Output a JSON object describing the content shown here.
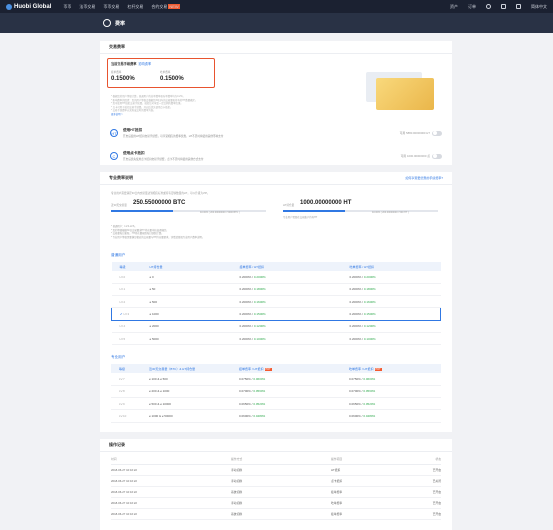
{
  "topbar": {
    "logo": "Huobi Global",
    "nav": [
      "币币",
      "法币交易",
      "币币交易",
      "杠杆交易",
      "合约交易"
    ],
    "new_tag": "NEW",
    "right": [
      "资产",
      "订单",
      "简体中文"
    ]
  },
  "page": {
    "title": "费率"
  },
  "fee_section": {
    "header": "交易费率",
    "current_rate_label": "当前交易手续费率",
    "current_rate_link": "影响费率",
    "maker_label": "挂单费率",
    "maker_value": "0.1500%",
    "taker_label": "吃单费率",
    "taker_value": "0.1500%",
    "notes": [
      "* 根据您的用户等级计算，普通用户的挂单费率和吃单费率均为0.2%。",
      "* 影响费率的因素：您的用户等级会根据您30日内的交易量和持有的HT数量确定。",
      "* 您可使用HT抵扣交易手续费，抵扣后可享受一定比例的费率优惠。",
      "* 点卡可用于抵扣交易手续费，开启后优先使用点卡抵扣。",
      "* 交易手续费率以实际成交时的费率为准。"
    ],
    "more_link": "更多说明 >"
  },
  "options": [
    {
      "icon": "HT",
      "title": "使用HT抵扣",
      "desc": "开启后使用HT抵扣交易手续费，可享受相应的费率优惠，HT不足时将使用其他币种支付",
      "right": "可用 5880.00000000 HT"
    },
    {
      "icon": "C",
      "title": "使用点卡抵扣",
      "desc": "开启后优先使用点卡抵扣交易手续费，点卡不足时将使用其他方式支付",
      "right": "可用 1000.00000000 点"
    }
  ],
  "vip": {
    "header": "专业费率说明",
    "header_link": "如何享受更优惠的手续费率?",
    "intro": "专业用户需要满足30日内交易量达到相应标准或持有足够数量的HT，可以升级为VIP。",
    "volume_label": "近30天交易量",
    "volume_value": "250.55000000 BTC",
    "volume_progress": 0.4,
    "volume_range": "40.00% ( 200.00000000 / 5000 BTC )",
    "ht_label": "HT持仓量",
    "ht_value": "1000.00000000 HT",
    "ht_progress": 0.4,
    "ht_range": "40.00% ( 200.00000000 / 500 HT )",
    "ht_note": "专业用户需要在交易账户持有HT",
    "rules": [
      "* 普通用户：LV.0-LV.6。",
      "* 您的等级根据30日交易量或HT持仓量中较高者确定。",
      "* 交易量每日更新，HT持仓量按照每日快照计算。",
      "* 专业用户等级需要满足相应的交易量与HT持仓量要求，详情请参阅专业用户费率说明。"
    ]
  },
  "normal_table": {
    "title": "普通用户",
    "headers": [
      "等级",
      "HT持仓量",
      "挂单费率 / HT抵扣",
      "吃单费率 / HT抵扣"
    ],
    "rows": [
      {
        "level": "LV.0",
        "ht": "≥ 0",
        "maker": "0.2000%",
        "maker_ht": "0.2000%",
        "taker": "0.2000%",
        "taker_ht": "0.2000%"
      },
      {
        "level": "LV.1",
        "ht": "≥ 50",
        "maker": "0.2000%",
        "maker_ht": "0.1800%",
        "taker": "0.2000%",
        "taker_ht": "0.1800%"
      },
      {
        "level": "LV.2",
        "ht": "≥ 500",
        "maker": "0.2000%",
        "maker_ht": "0.1600%",
        "taker": "0.2000%",
        "taker_ht": "0.1600%"
      },
      {
        "level": "LV.3",
        "ht": "≥ 1000",
        "maker": "0.2000%",
        "maker_ht": "0.1500%",
        "taker": "0.2000%",
        "taker_ht": "0.1500%"
      },
      {
        "level": "LV.4",
        "ht": "≥ 2000",
        "maker": "0.2000%",
        "maker_ht": "0.1200%",
        "taker": "0.2000%",
        "taker_ht": "0.1200%"
      },
      {
        "level": "LV.5",
        "ht": "≥ 5000",
        "maker": "0.2000%",
        "maker_ht": "0.1000%",
        "taker": "0.2000%",
        "taker_ht": "0.1000%"
      }
    ],
    "current_index": 3
  },
  "pro_table": {
    "title": "专业用户",
    "headers": [
      "等级",
      "近30天交易量（BTC）& HT持仓量",
      "挂单费率 / HT抵扣",
      "吃单费率 / HT抵扣"
    ],
    "hot": "HOT",
    "rows": [
      {
        "level": "LV.7",
        "cond": "≥ 100 & ≥ 500",
        "maker": "0.0750%",
        "maker_ht": "0.0600%",
        "taker": "0.0750%",
        "taker_ht": "0.0600%"
      },
      {
        "level": "LV.8",
        "cond": "≥ 200 & ≥ 1000",
        "maker": "0.0700%",
        "maker_ht": "0.0560%",
        "taker": "0.0700%",
        "taker_ht": "0.0560%"
      },
      {
        "level": "LV.9",
        "cond": "≥ 500 & ≥ 10000",
        "maker": "0.0650%",
        "maker_ht": "0.0520%",
        "taker": "0.0650%",
        "taker_ht": "0.0520%"
      },
      {
        "level": "LV.10",
        "cond": "≥ 1000 & ≥ 50000",
        "maker": "0.0600%",
        "maker_ht": "0.0480%",
        "taker": "0.0600%",
        "taker_ht": "0.0480%"
      }
    ]
  },
  "history": {
    "header": "操作记录",
    "headers": [
      "时间",
      "操作方式",
      "操作项目",
      "状态"
    ],
    "rows": [
      {
        "time": "2018-06-27 10:16:22",
        "method": "手动切换",
        "item": "HT抵扣",
        "status": "已开启"
      },
      {
        "time": "2018-06-27 10:16:22",
        "method": "手动切换",
        "item": "点卡抵扣",
        "status": "已关闭"
      },
      {
        "time": "2018-06-27 10:16:22",
        "method": "系统切换",
        "item": "挂单费率",
        "status": "已开启"
      },
      {
        "time": "2018-06-27 10:16:22",
        "method": "手动切换",
        "item": "吃单费率",
        "status": "已开启"
      },
      {
        "time": "2018-06-27 10:16:22",
        "method": "系统切换",
        "item": "挂单费率",
        "status": "已开启"
      }
    ]
  }
}
